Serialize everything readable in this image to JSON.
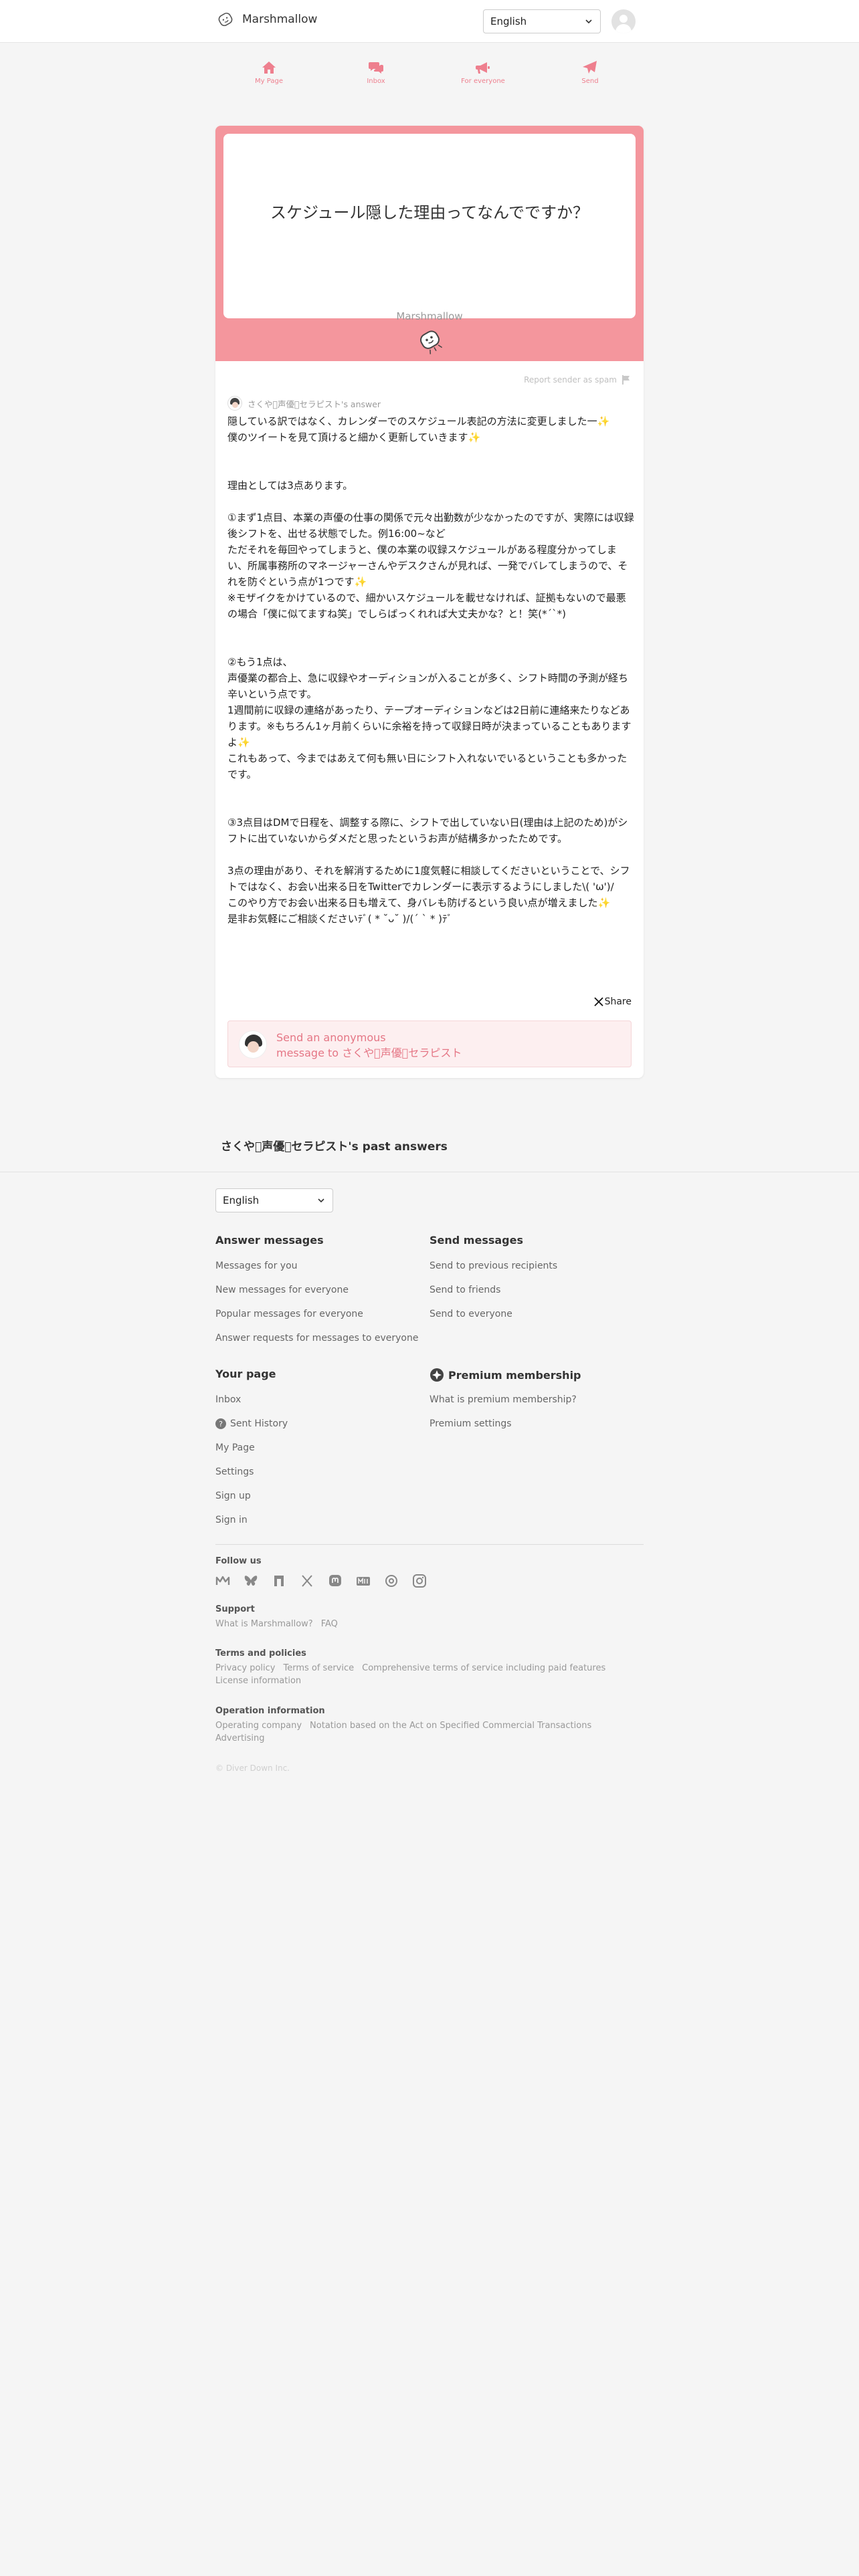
{
  "header": {
    "brand": "Marshmallow",
    "language": "English"
  },
  "nav": [
    {
      "label": "My Page",
      "icon": "home-icon"
    },
    {
      "label": "Inbox",
      "icon": "chat-bubbles-icon"
    },
    {
      "label": "For everyone",
      "icon": "megaphone-icon"
    },
    {
      "label": "Send",
      "icon": "paper-plane-icon"
    }
  ],
  "question": {
    "text": "スケジュール隠した理由ってなんでですか？",
    "brand": "Marshmallow"
  },
  "report_label": "Report sender as spam",
  "answer": {
    "author": "さくや􀀀声優􀀁セラピスト's answer",
    "paragraphs": [
      "隠している訳ではなく、カレンダーでのスケジュール表記の方法に変更しました一✨",
      "僕のツイートを見て頂けると細かく更新していきます✨",
      "",
      "",
      "理由としては3点あります。",
      "",
      "①まず1点目、本業の声優の仕事の関係で元々出勤数が少なかったのですが、実際には収録後シフトを、出せる状態でした。例16:00~など",
      "ただそれを毎回やってしまうと、僕の本業の収録スケジュールがある程度分かってしまい、所属事務所のマネージャーさんやデスクさんが見れば、一発でバレてしまうので、それを防ぐという点が1つです✨",
      "※モザイクをかけているので、細かいスケジュールを載せなければ、証拠もないので最悪の場合「僕に似てますね笑」でしらばっくれれば大丈夫かな？と！笑(*´`*)",
      "",
      "",
      "②もう1点は、",
      "声優業の都合上、急に収録やオーディションが入ることが多く、シフト時間の予測が経ち辛いという点です。",
      "1週間前に収録の連絡があったり、テープオーディションなどは2日前に連絡来たりなどあります。※もちろん1ヶ月前くらいに余裕を持って収録日時が決まっていることもありますよ✨",
      "これもあって、今まではあえて何も無い日にシフト入れないでいるということも多かったです。",
      "",
      "",
      "③3点目はDMで日程を、調整する際に、シフトで出していない日(理由は上記のため)がシフトに出ていないからダメだと思ったというお声が結構多かったためです。",
      "",
      "3点の理由があり、それを解消するために1度気軽に相談してくださいということで、シフトではなく、お会い出来る日をTwitterでカレンダーに表示するようにしました\\( 'ω')/",
      "このやり方でお会い出来る日も増えて、身バレも防げるという良い点が増えました✨",
      "是非お気軽にご相談くださいﾃﾞ( * ˘ᴗ˘ )/(´ ` * )ﾃﾞ"
    ]
  },
  "share_label": "Share",
  "send_box": {
    "line1": "Send an anonymous",
    "line2": "message to さくや􀀀声優􀀁セラピスト"
  },
  "past_answers_title": "さくや􀀀声優􀀁セラピスト's past answers",
  "footer": {
    "language": "English",
    "answer_messages": {
      "title": "Answer messages",
      "links": [
        "Messages for you",
        "New messages for everyone",
        "Popular messages for everyone",
        "Answer requests for messages to everyone"
      ]
    },
    "send_messages": {
      "title": "Send messages",
      "links": [
        "Send to previous recipients",
        "Send to friends",
        "Send to everyone"
      ]
    },
    "your_page": {
      "title": "Your page",
      "links": [
        "Inbox",
        "Sent History",
        "My Page",
        "Settings",
        "Sign up",
        "Sign in"
      ]
    },
    "premium": {
      "title": "Premium membership",
      "links": [
        "What is premium membership?",
        "Premium settings"
      ]
    },
    "follow_us": "Follow us",
    "support": {
      "title": "Support",
      "links": [
        "What is Marshmallow?",
        "FAQ"
      ]
    },
    "terms": {
      "title": "Terms and policies",
      "links": [
        "Privacy policy",
        "Terms of service",
        "Comprehensive terms of service including paid features",
        "License information"
      ]
    },
    "operation": {
      "title": "Operation information",
      "links": [
        "Operating company",
        "Notation based on the Act on Specified Commercial Transactions",
        "Advertising"
      ]
    },
    "copyright": "© Diver Down Inc."
  },
  "colors": {
    "accent": "#f4969d",
    "nav": "#ee7f8e",
    "send_text": "#e57685"
  }
}
